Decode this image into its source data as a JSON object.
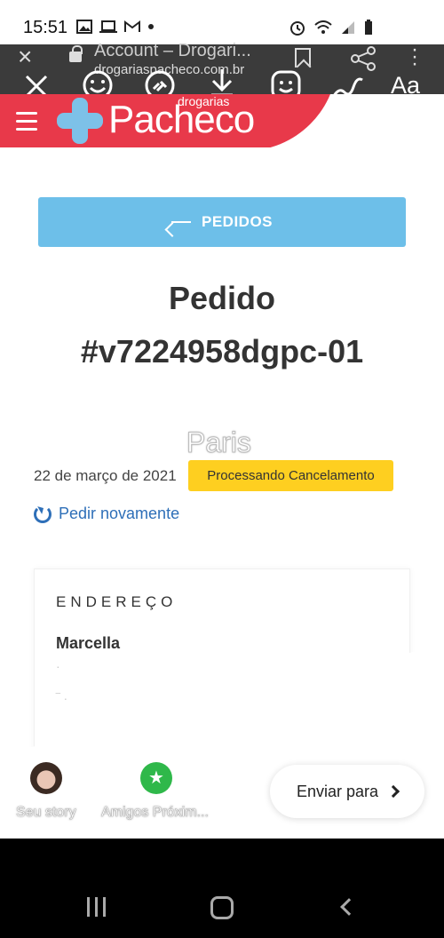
{
  "status_bar": {
    "time": "15:51"
  },
  "browser": {
    "page_title": "Account – Drogari...",
    "url": "drogariaspacheco.com.br"
  },
  "site": {
    "logo_small": "drogarias",
    "logo_main": "Pacheco"
  },
  "page": {
    "back_label": "PEDIDOS",
    "order_title_line1": "Pedido",
    "order_title_line2": "#v7224958dgpc-01",
    "sticker_text": "Paris",
    "order_date": "22 de março de 2021",
    "status_badge": "Processando Cancelamento",
    "reorder_label": "Pedir novamente",
    "address_heading": "ENDEREÇO",
    "address_name": "Marcella"
  },
  "story_share": {
    "your_story_label": "Seu story",
    "friends_label": "Amigos Próxim...",
    "send_label": "Enviar para"
  },
  "colors": {
    "brand_red": "#e8394a",
    "brand_blue": "#6dbfe9",
    "badge_yellow": "#fecf20",
    "link_blue": "#2e6fb8"
  }
}
